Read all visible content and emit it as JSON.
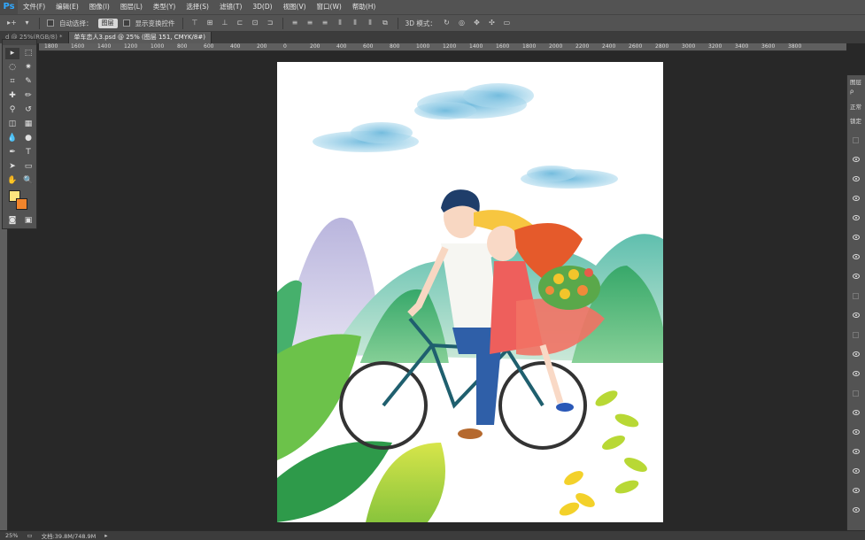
{
  "app": {
    "logo": "Ps"
  },
  "menu": [
    "文件(F)",
    "编辑(E)",
    "图像(I)",
    "图层(L)",
    "类型(Y)",
    "选择(S)",
    "滤镜(T)",
    "3D(D)",
    "视图(V)",
    "窗口(W)",
    "帮助(H)"
  ],
  "options": {
    "auto_select_label": "自动选择：",
    "auto_select_value": "图层",
    "show_transform_label": "显示变换控件",
    "mode_3d_label": "3D 模式："
  },
  "tabs": [
    {
      "label": "d @ 25%(RGB/8) *",
      "active": false
    },
    {
      "label": "单车恋人3.psd @ 25% (图层 151, CMYK/8#)",
      "active": true
    }
  ],
  "ruler": {
    "labels": [
      "1800",
      "1600",
      "1400",
      "1200",
      "1000",
      "800",
      "600",
      "400",
      "200",
      "0",
      "200",
      "400",
      "600",
      "800",
      "1000",
      "1200",
      "1400",
      "1600",
      "1800",
      "2000",
      "2200",
      "2400",
      "2600",
      "2800",
      "3000",
      "3200",
      "3400",
      "3600",
      "3800"
    ]
  },
  "tools": {
    "icons": [
      "move-icon",
      "marquee-icon",
      "lasso-icon",
      "magic-wand-icon",
      "crop-icon",
      "eyedropper-icon",
      "healing-icon",
      "brush-icon",
      "stamp-icon",
      "history-brush-icon",
      "eraser-icon",
      "gradient-icon",
      "blur-icon",
      "dodge-icon",
      "pen-icon",
      "type-icon",
      "path-select-icon",
      "shape-icon",
      "hand-icon",
      "zoom-icon"
    ]
  },
  "colors": {
    "foreground": "#fde57e",
    "background": "#f2852c",
    "accent": "#30a8ff"
  },
  "layers_panel": {
    "title": "图层",
    "search": "ρ",
    "blend": "正常",
    "lock": "锁定"
  },
  "status": {
    "zoom": "25%",
    "doc_info": "文档:39.8M/748.9M"
  }
}
